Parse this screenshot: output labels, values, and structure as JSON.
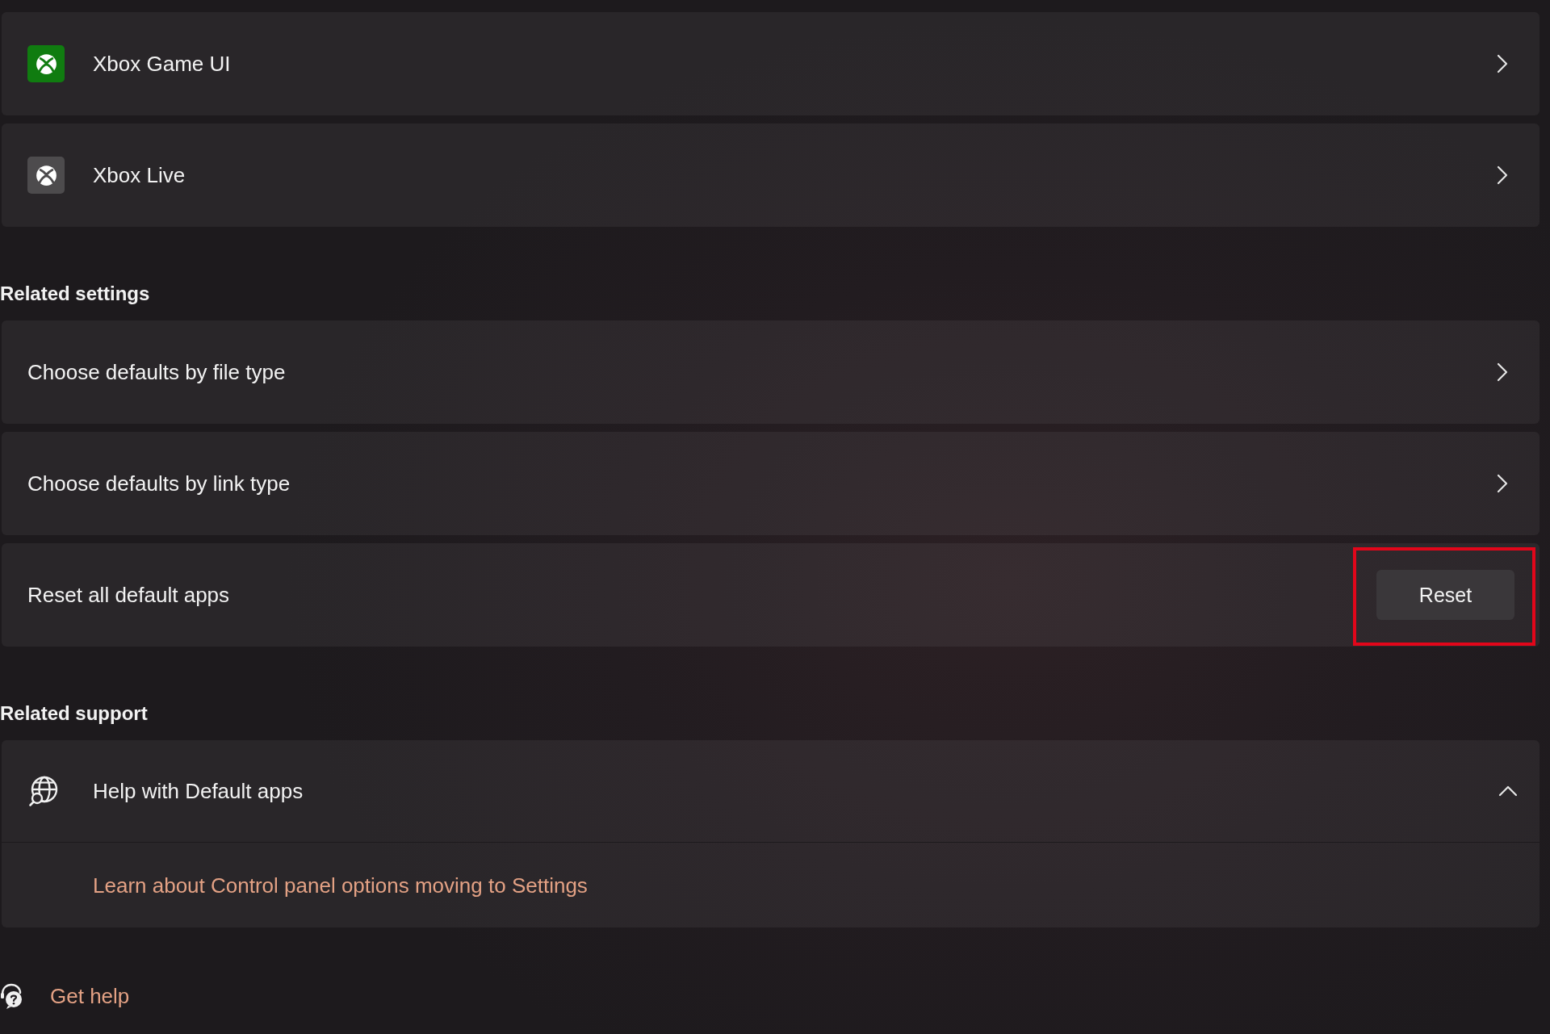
{
  "apps": [
    {
      "name": "Xbox Game UI",
      "color": "#107c10"
    },
    {
      "name": "Xbox Live",
      "color": "#4d4b4d"
    }
  ],
  "related_settings": {
    "heading": "Related settings",
    "items": [
      {
        "kind": "link",
        "label": "Choose defaults by file type"
      },
      {
        "kind": "link",
        "label": "Choose defaults by link type"
      },
      {
        "kind": "action",
        "label": "Reset all default apps",
        "button": "Reset",
        "highlighted": true
      }
    ]
  },
  "related_support": {
    "heading": "Related support",
    "items": [
      {
        "label": "Help with Default apps",
        "expanded": true,
        "links": [
          "Learn about Control panel options moving to Settings"
        ]
      }
    ]
  },
  "footer_links": [
    {
      "label": "Get help"
    }
  ]
}
